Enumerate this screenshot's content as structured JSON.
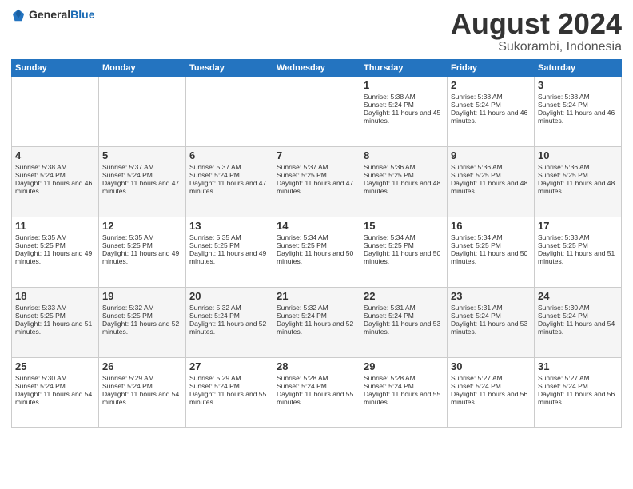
{
  "header": {
    "logo_general": "General",
    "logo_blue": "Blue",
    "title": "August 2024",
    "location": "Sukorambi, Indonesia"
  },
  "days_of_week": [
    "Sunday",
    "Monday",
    "Tuesday",
    "Wednesday",
    "Thursday",
    "Friday",
    "Saturday"
  ],
  "weeks": [
    [
      {
        "day": "",
        "sunrise": "",
        "sunset": "",
        "daylight": ""
      },
      {
        "day": "",
        "sunrise": "",
        "sunset": "",
        "daylight": ""
      },
      {
        "day": "",
        "sunrise": "",
        "sunset": "",
        "daylight": ""
      },
      {
        "day": "",
        "sunrise": "",
        "sunset": "",
        "daylight": ""
      },
      {
        "day": "1",
        "sunrise": "Sunrise: 5:38 AM",
        "sunset": "Sunset: 5:24 PM",
        "daylight": "Daylight: 11 hours and 45 minutes."
      },
      {
        "day": "2",
        "sunrise": "Sunrise: 5:38 AM",
        "sunset": "Sunset: 5:24 PM",
        "daylight": "Daylight: 11 hours and 46 minutes."
      },
      {
        "day": "3",
        "sunrise": "Sunrise: 5:38 AM",
        "sunset": "Sunset: 5:24 PM",
        "daylight": "Daylight: 11 hours and 46 minutes."
      }
    ],
    [
      {
        "day": "4",
        "sunrise": "Sunrise: 5:38 AM",
        "sunset": "Sunset: 5:24 PM",
        "daylight": "Daylight: 11 hours and 46 minutes."
      },
      {
        "day": "5",
        "sunrise": "Sunrise: 5:37 AM",
        "sunset": "Sunset: 5:24 PM",
        "daylight": "Daylight: 11 hours and 47 minutes."
      },
      {
        "day": "6",
        "sunrise": "Sunrise: 5:37 AM",
        "sunset": "Sunset: 5:24 PM",
        "daylight": "Daylight: 11 hours and 47 minutes."
      },
      {
        "day": "7",
        "sunrise": "Sunrise: 5:37 AM",
        "sunset": "Sunset: 5:25 PM",
        "daylight": "Daylight: 11 hours and 47 minutes."
      },
      {
        "day": "8",
        "sunrise": "Sunrise: 5:36 AM",
        "sunset": "Sunset: 5:25 PM",
        "daylight": "Daylight: 11 hours and 48 minutes."
      },
      {
        "day": "9",
        "sunrise": "Sunrise: 5:36 AM",
        "sunset": "Sunset: 5:25 PM",
        "daylight": "Daylight: 11 hours and 48 minutes."
      },
      {
        "day": "10",
        "sunrise": "Sunrise: 5:36 AM",
        "sunset": "Sunset: 5:25 PM",
        "daylight": "Daylight: 11 hours and 48 minutes."
      }
    ],
    [
      {
        "day": "11",
        "sunrise": "Sunrise: 5:35 AM",
        "sunset": "Sunset: 5:25 PM",
        "daylight": "Daylight: 11 hours and 49 minutes."
      },
      {
        "day": "12",
        "sunrise": "Sunrise: 5:35 AM",
        "sunset": "Sunset: 5:25 PM",
        "daylight": "Daylight: 11 hours and 49 minutes."
      },
      {
        "day": "13",
        "sunrise": "Sunrise: 5:35 AM",
        "sunset": "Sunset: 5:25 PM",
        "daylight": "Daylight: 11 hours and 49 minutes."
      },
      {
        "day": "14",
        "sunrise": "Sunrise: 5:34 AM",
        "sunset": "Sunset: 5:25 PM",
        "daylight": "Daylight: 11 hours and 50 minutes."
      },
      {
        "day": "15",
        "sunrise": "Sunrise: 5:34 AM",
        "sunset": "Sunset: 5:25 PM",
        "daylight": "Daylight: 11 hours and 50 minutes."
      },
      {
        "day": "16",
        "sunrise": "Sunrise: 5:34 AM",
        "sunset": "Sunset: 5:25 PM",
        "daylight": "Daylight: 11 hours and 50 minutes."
      },
      {
        "day": "17",
        "sunrise": "Sunrise: 5:33 AM",
        "sunset": "Sunset: 5:25 PM",
        "daylight": "Daylight: 11 hours and 51 minutes."
      }
    ],
    [
      {
        "day": "18",
        "sunrise": "Sunrise: 5:33 AM",
        "sunset": "Sunset: 5:25 PM",
        "daylight": "Daylight: 11 hours and 51 minutes."
      },
      {
        "day": "19",
        "sunrise": "Sunrise: 5:32 AM",
        "sunset": "Sunset: 5:25 PM",
        "daylight": "Daylight: 11 hours and 52 minutes."
      },
      {
        "day": "20",
        "sunrise": "Sunrise: 5:32 AM",
        "sunset": "Sunset: 5:24 PM",
        "daylight": "Daylight: 11 hours and 52 minutes."
      },
      {
        "day": "21",
        "sunrise": "Sunrise: 5:32 AM",
        "sunset": "Sunset: 5:24 PM",
        "daylight": "Daylight: 11 hours and 52 minutes."
      },
      {
        "day": "22",
        "sunrise": "Sunrise: 5:31 AM",
        "sunset": "Sunset: 5:24 PM",
        "daylight": "Daylight: 11 hours and 53 minutes."
      },
      {
        "day": "23",
        "sunrise": "Sunrise: 5:31 AM",
        "sunset": "Sunset: 5:24 PM",
        "daylight": "Daylight: 11 hours and 53 minutes."
      },
      {
        "day": "24",
        "sunrise": "Sunrise: 5:30 AM",
        "sunset": "Sunset: 5:24 PM",
        "daylight": "Daylight: 11 hours and 54 minutes."
      }
    ],
    [
      {
        "day": "25",
        "sunrise": "Sunrise: 5:30 AM",
        "sunset": "Sunset: 5:24 PM",
        "daylight": "Daylight: 11 hours and 54 minutes."
      },
      {
        "day": "26",
        "sunrise": "Sunrise: 5:29 AM",
        "sunset": "Sunset: 5:24 PM",
        "daylight": "Daylight: 11 hours and 54 minutes."
      },
      {
        "day": "27",
        "sunrise": "Sunrise: 5:29 AM",
        "sunset": "Sunset: 5:24 PM",
        "daylight": "Daylight: 11 hours and 55 minutes."
      },
      {
        "day": "28",
        "sunrise": "Sunrise: 5:28 AM",
        "sunset": "Sunset: 5:24 PM",
        "daylight": "Daylight: 11 hours and 55 minutes."
      },
      {
        "day": "29",
        "sunrise": "Sunrise: 5:28 AM",
        "sunset": "Sunset: 5:24 PM",
        "daylight": "Daylight: 11 hours and 55 minutes."
      },
      {
        "day": "30",
        "sunrise": "Sunrise: 5:27 AM",
        "sunset": "Sunset: 5:24 PM",
        "daylight": "Daylight: 11 hours and 56 minutes."
      },
      {
        "day": "31",
        "sunrise": "Sunrise: 5:27 AM",
        "sunset": "Sunset: 5:24 PM",
        "daylight": "Daylight: 11 hours and 56 minutes."
      }
    ]
  ]
}
